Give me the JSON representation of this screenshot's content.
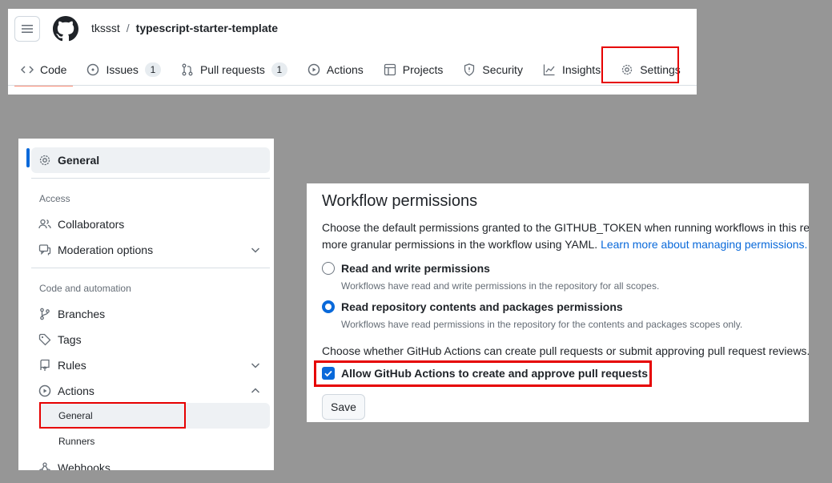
{
  "repo": {
    "owner": "tkssst",
    "separator": "/",
    "name": "typescript-starter-template"
  },
  "tabs": [
    {
      "label": "Code",
      "icon": "code-icon",
      "count": null,
      "active": true
    },
    {
      "label": "Issues",
      "icon": "issue-opened-icon",
      "count": "1"
    },
    {
      "label": "Pull requests",
      "icon": "git-pull-request-icon",
      "count": "1"
    },
    {
      "label": "Actions",
      "icon": "play-icon",
      "count": null
    },
    {
      "label": "Projects",
      "icon": "table-icon",
      "count": null
    },
    {
      "label": "Security",
      "icon": "shield-icon",
      "count": null
    },
    {
      "label": "Insights",
      "icon": "graph-icon",
      "count": null
    },
    {
      "label": "Settings",
      "icon": "gear-icon",
      "count": null
    }
  ],
  "sidebar": {
    "general": "General",
    "access_heading": "Access",
    "collaborators": "Collaborators",
    "moderation": "Moderation options",
    "code_heading": "Code and automation",
    "branches": "Branches",
    "tags": "Tags",
    "rules": "Rules",
    "actions": "Actions",
    "actions_general": "General",
    "runners": "Runners",
    "webhooks": "Webhooks"
  },
  "workflow": {
    "title": "Workflow permissions",
    "desc_line1": "Choose the default permissions granted to the GITHUB_TOKEN when running workflows in this repo",
    "desc_line2": "more granular permissions in the workflow using YAML.",
    "learn_more": "Learn more about managing permissions.",
    "option_rw_label": "Read and write permissions",
    "option_rw_note": "Workflows have read and write permissions in the repository for all scopes.",
    "option_ro_label": "Read repository contents and packages permissions",
    "option_ro_note": "Workflows have read permissions in the repository for the contents and packages scopes only.",
    "question": "Choose whether GitHub Actions can create pull requests or submit approving pull request reviews.",
    "allow_label": "Allow GitHub Actions to create and approve pull requests",
    "save": "Save"
  },
  "colors": {
    "accent": "#0969da",
    "highlight": "#e60000",
    "tab_underline": "#fd8c73",
    "background": "#969696"
  }
}
